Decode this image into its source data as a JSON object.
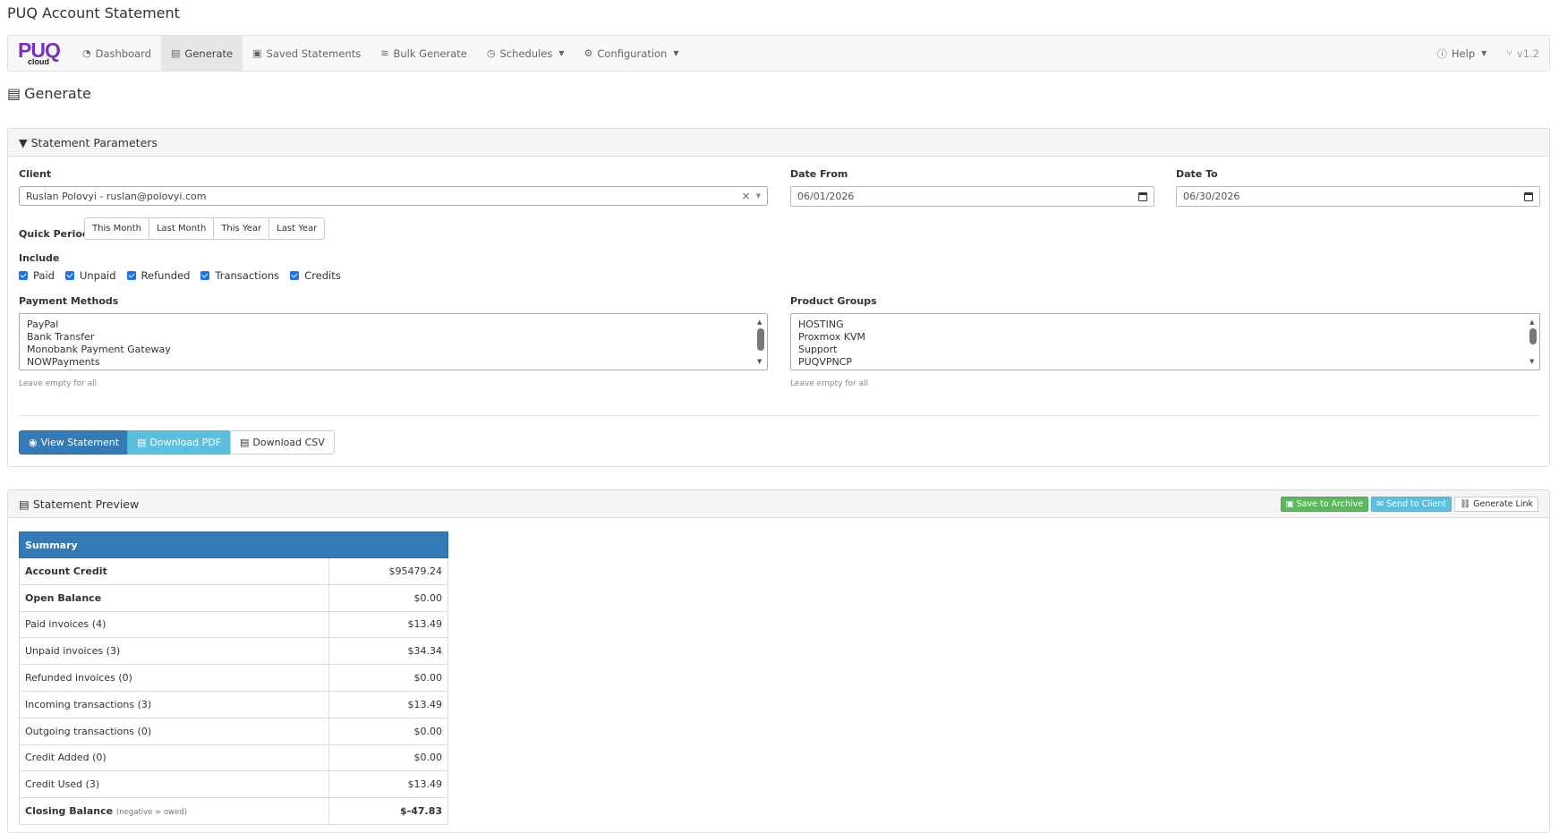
{
  "app": {
    "title": "PUQ Account Statement"
  },
  "brand": {
    "logo_text": "PUQ",
    "logo_sub": "cloud"
  },
  "nav": {
    "items": [
      {
        "label": "Dashboard",
        "icon": "dashboard-icon"
      },
      {
        "label": "Generate",
        "icon": "file-icon",
        "active": true
      },
      {
        "label": "Saved Statements",
        "icon": "archive-icon"
      },
      {
        "label": "Bulk Generate",
        "icon": "layers-icon"
      },
      {
        "label": "Schedules",
        "icon": "clock-icon",
        "dropdown": true
      },
      {
        "label": "Configuration",
        "icon": "cogs-icon",
        "dropdown": true
      }
    ],
    "help": "Help",
    "version": "v1.2"
  },
  "page": {
    "heading": "Generate"
  },
  "params": {
    "title": "Statement Parameters",
    "client_label": "Client",
    "client_value": "Ruslan Polovyi - ruslan@polovyi.com",
    "date_from_label": "Date From",
    "date_from": "06/01/2026",
    "date_to_label": "Date To",
    "date_to": "06/30/2026",
    "quick_period_label": "Quick Period",
    "quick_periods": [
      "This Month",
      "Last Month",
      "This Year",
      "Last Year"
    ],
    "include_label": "Include",
    "include": [
      "Paid",
      "Unpaid",
      "Refunded",
      "Transactions",
      "Credits"
    ],
    "payment_methods_label": "Payment Methods",
    "payment_methods": [
      "PayPal",
      "Bank Transfer",
      "Monobank Payment Gateway",
      "NOWPayments"
    ],
    "product_groups_label": "Product Groups",
    "product_groups": [
      "HOSTING",
      "Proxmox KVM",
      "Support",
      "PUQVPNCP"
    ],
    "empty_hint": "Leave empty for all",
    "buttons": {
      "view": "View Statement",
      "pdf": "Download PDF",
      "csv": "Download CSV"
    }
  },
  "preview": {
    "title": "Statement Preview",
    "actions": {
      "archive": "Save to Archive",
      "send": "Send to Client",
      "link": "Generate Link"
    },
    "summary_header": "Summary",
    "rows": [
      {
        "label": "Account Credit",
        "value": "$95479.24",
        "bold": true
      },
      {
        "label": "Open Balance",
        "value": "$0.00",
        "bold": true
      },
      {
        "label": "Paid invoices (4)",
        "value": "$13.49"
      },
      {
        "label": "Unpaid invoices (3)",
        "value": "$34.34"
      },
      {
        "label": "Refunded invoices (0)",
        "value": "$0.00"
      },
      {
        "label": "Incoming transactions (3)",
        "value": "$13.49"
      },
      {
        "label": "Outgoing transactions (0)",
        "value": "$0.00"
      },
      {
        "label": "Credit Added (0)",
        "value": "$0.00"
      },
      {
        "label": "Credit Used (3)",
        "value": "$13.49"
      }
    ],
    "closing_label": "Closing Balance",
    "closing_note": "(negative = owed)",
    "closing_value": "$-47.83"
  },
  "colors": {
    "primary": "#337ab7",
    "info": "#5bc0de",
    "success": "#5cb85c",
    "brand": "#7b2fbe"
  }
}
